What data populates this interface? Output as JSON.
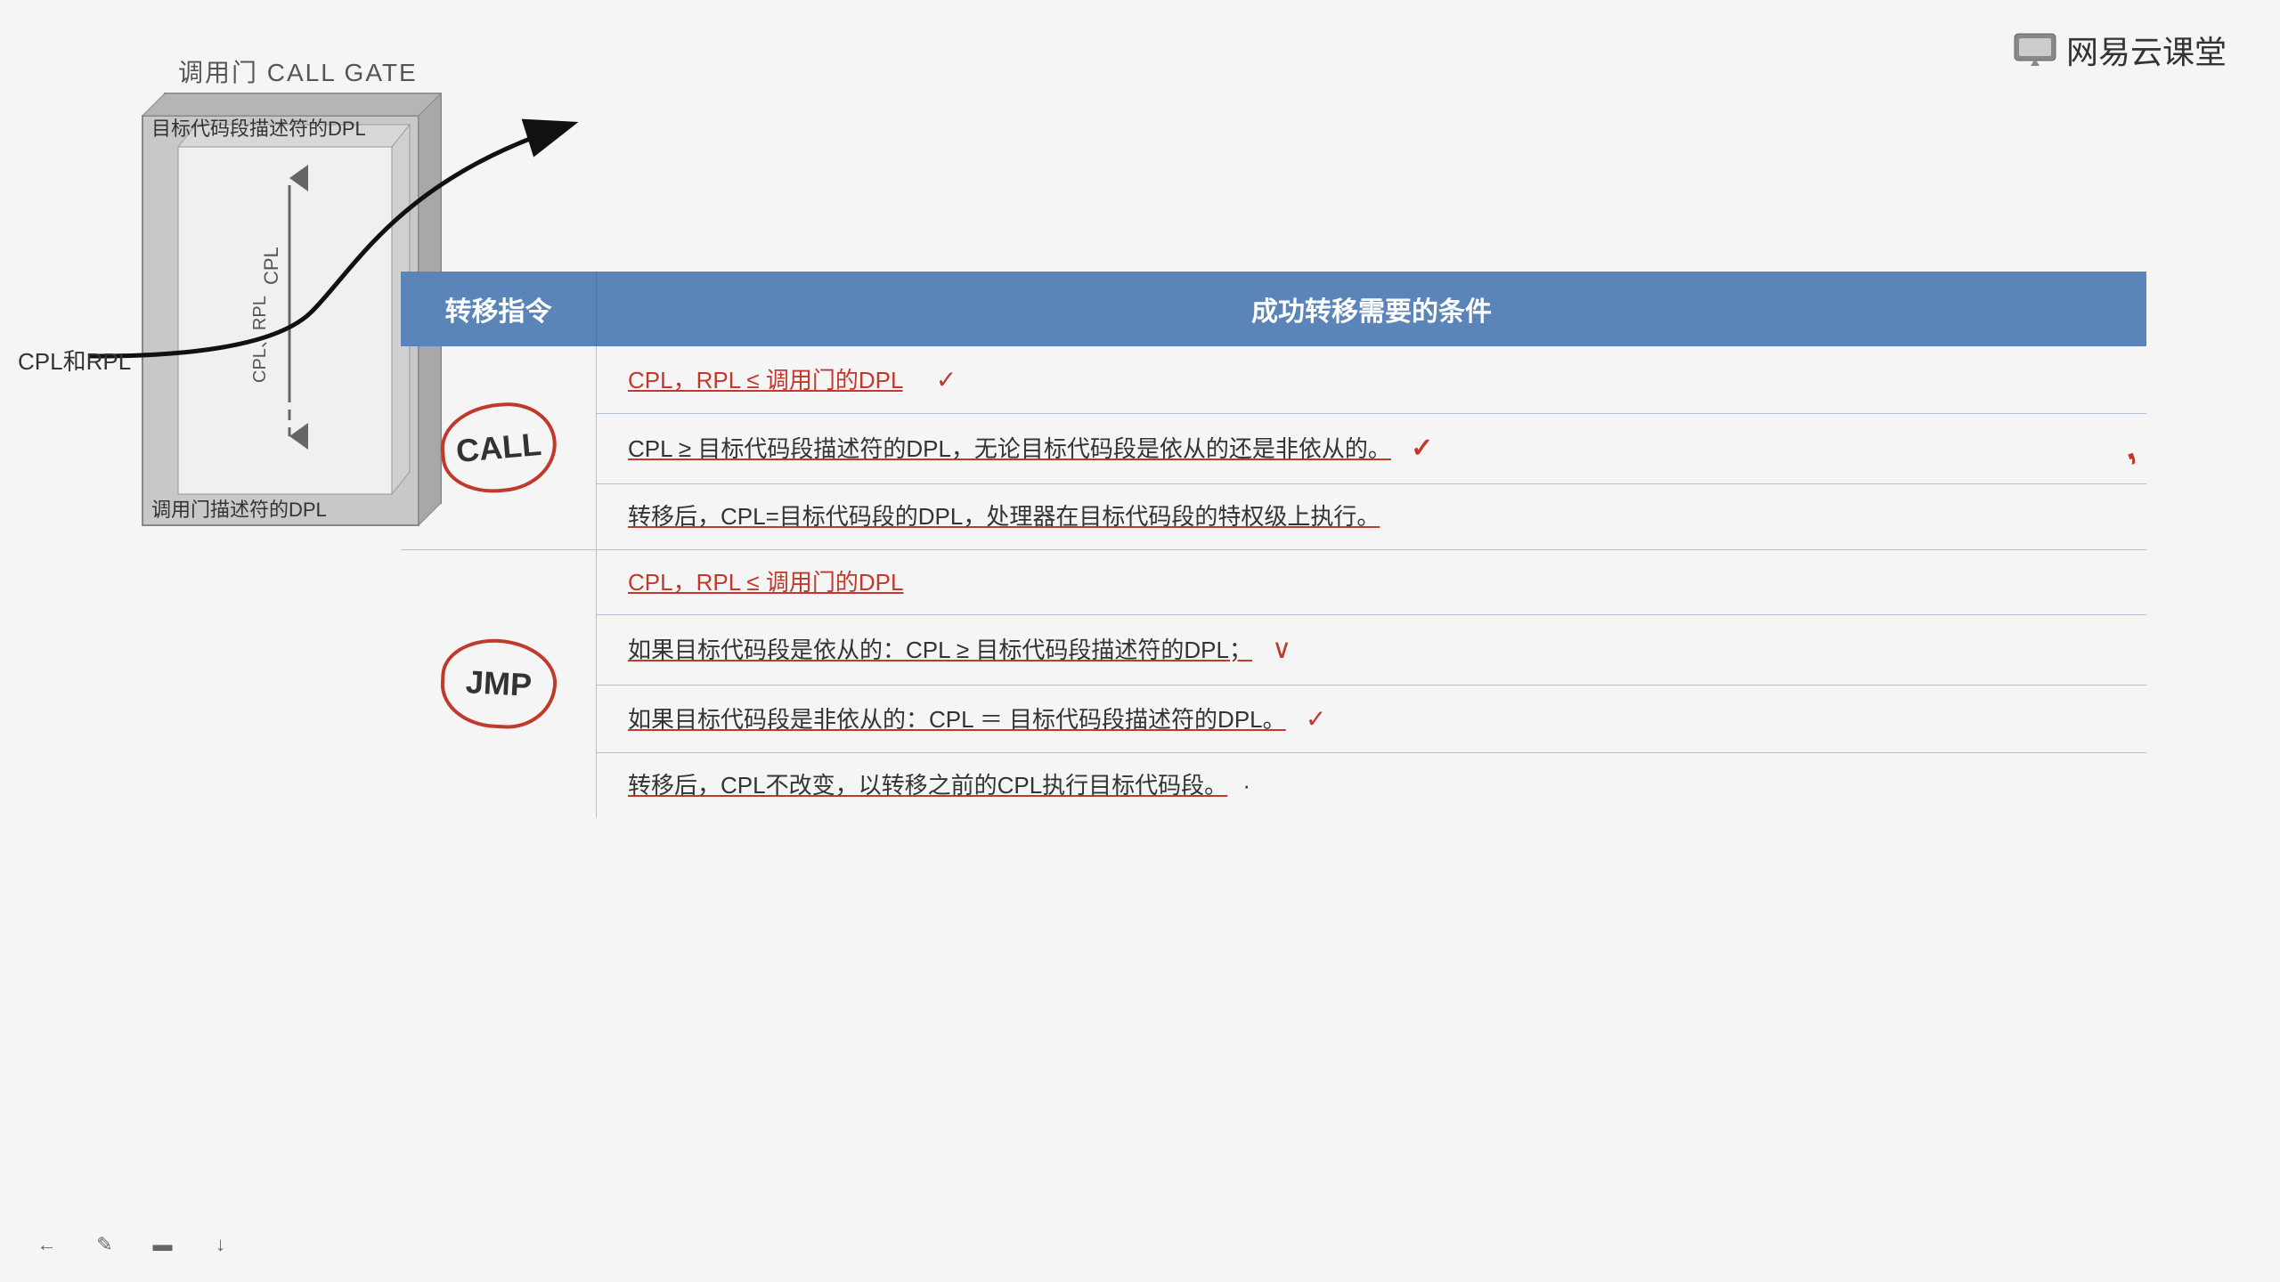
{
  "logo": {
    "text": "网易云课堂",
    "icon": "💬"
  },
  "title": "调用门 CALL GATE",
  "diagram": {
    "label_dpl_target": "目标代码段描述符的DPL",
    "label_cpl": "CPL",
    "label_cpl_rpl": "CPL、RPL",
    "label_dpl_gate": "调用门描述符的DPL",
    "label_cpl_rpl_left": "CPL和RPL"
  },
  "table": {
    "header": {
      "col1": "转移指令",
      "col2": "成功转移需要的条件"
    },
    "rows": [
      {
        "instruction": "CALL",
        "conditions": [
          {
            "text": "CPL，RPL ≤ 调用门的DPL",
            "style": "red",
            "has_check": true,
            "underlined": true
          },
          {
            "text": "CPL ≥ 目标代码段描述符的DPL，无论目标代码段是依从的还是非依从的。",
            "style": "black",
            "has_check": false,
            "underlined": true,
            "has_red_mark": true
          },
          {
            "text": "转移后，CPL=目标代码段的DPL，处理器在目标代码段的特权级上执行。",
            "style": "black",
            "has_check": false,
            "underlined": true
          }
        ]
      },
      {
        "instruction": "JMP",
        "conditions": [
          {
            "text": "CPL，RPL ≤ 调用门的DPL",
            "style": "red",
            "has_check": false,
            "underlined": true
          },
          {
            "text": "如果目标代码段是依从的：CPL ≥ 目标代码段描述符的DPL；",
            "style": "black",
            "has_check": true,
            "check_symbol": "∨",
            "underlined": true
          },
          {
            "text": "如果目标代码段是非依从的：CPL ＝ 目标代码段描述符的DPL。",
            "style": "black",
            "has_check": true,
            "check_symbol": "✓",
            "underlined": true
          },
          {
            "text": "转移后，CPL不改变，以转移之前的CPL执行目标代码段。",
            "style": "black",
            "has_check": false,
            "underlined": true
          }
        ]
      }
    ]
  },
  "toolbar": {
    "buttons": [
      "←",
      "✎",
      "▬",
      "↓"
    ]
  }
}
